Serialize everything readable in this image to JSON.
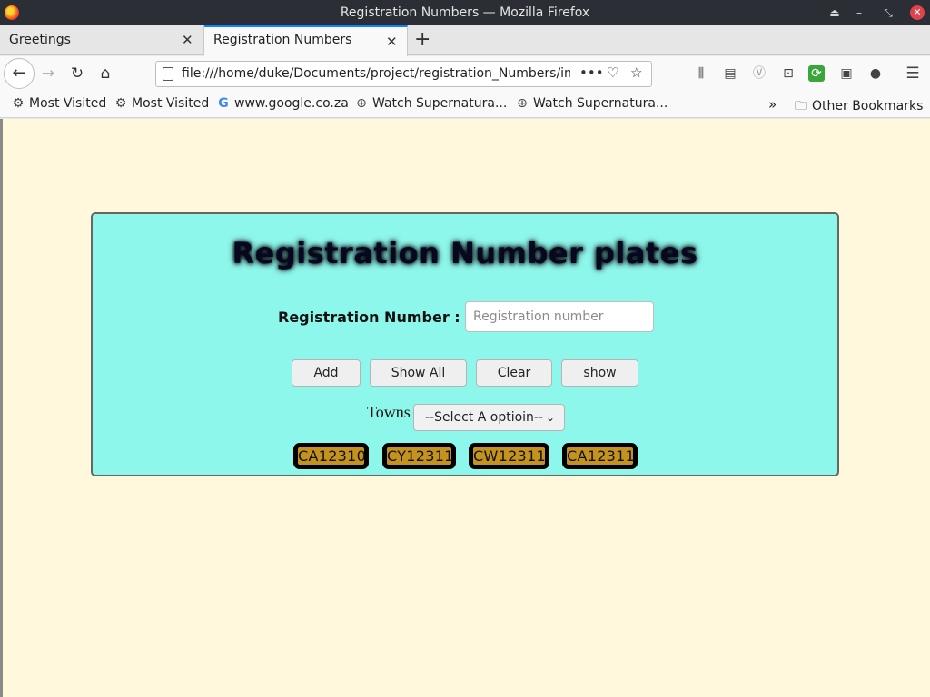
{
  "window": {
    "title": "Registration Numbers — Mozilla Firefox"
  },
  "tabs": [
    {
      "label": "Greetings",
      "active": false
    },
    {
      "label": "Registration Numbers",
      "active": true
    }
  ],
  "navbar": {
    "url": "file:///home/duke/Documents/project/registration_Numbers/in"
  },
  "bookmarks": {
    "items": [
      {
        "label": "Most Visited",
        "icon": "gear-icon"
      },
      {
        "label": "Most Visited",
        "icon": "gear-icon"
      },
      {
        "label": "www.google.co.za",
        "icon": "google-icon"
      },
      {
        "label": "Watch Supernatura...",
        "icon": "globe-icon"
      },
      {
        "label": "Watch Supernatura...",
        "icon": "globe-icon"
      }
    ],
    "other": "Other Bookmarks"
  },
  "page": {
    "heading": "Registration Number plates",
    "field_label": "Registration Number :",
    "input_placeholder": "Registration number",
    "buttons": {
      "add": "Add",
      "show_all": "Show All",
      "clear": "Clear",
      "show": "show"
    },
    "towns_label": "Towns",
    "towns_select": "--Select A optioin--",
    "plates": [
      "CA12310",
      "CY12311",
      "CW12311",
      "CA12311"
    ]
  },
  "colors": {
    "page_background": "#fff8dc",
    "card_background": "#8ef7ec",
    "plate_background": "#c4921f",
    "accent": "#0a84ff"
  }
}
